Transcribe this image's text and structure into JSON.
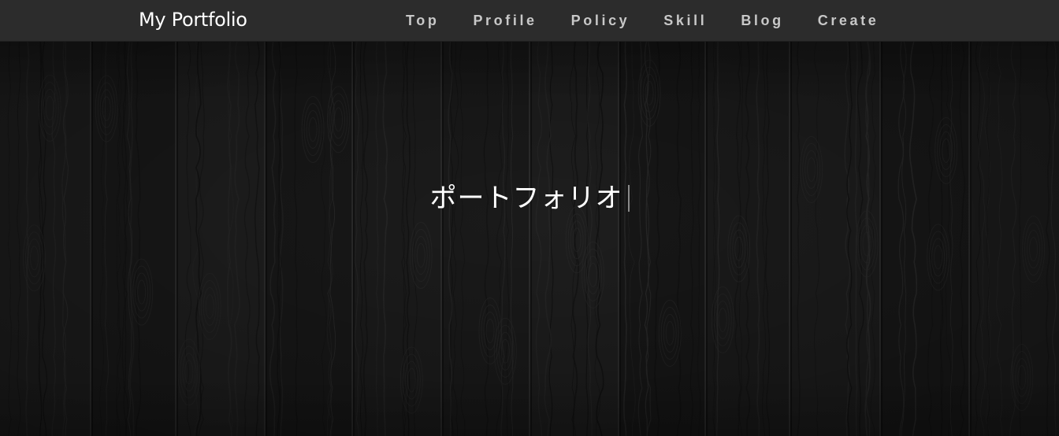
{
  "header": {
    "brand": "My Portfolio",
    "nav": [
      {
        "label": "Top"
      },
      {
        "label": "Profile"
      },
      {
        "label": "Policy"
      },
      {
        "label": "Skill"
      },
      {
        "label": "Blog"
      },
      {
        "label": "Create"
      }
    ]
  },
  "hero": {
    "title": "ポートフォリオ"
  },
  "colors": {
    "navbar_bg": "#2c2c2c",
    "hero_bg": "#161616",
    "nav_text": "#c8c8c8",
    "brand_text": "#ffffff"
  }
}
